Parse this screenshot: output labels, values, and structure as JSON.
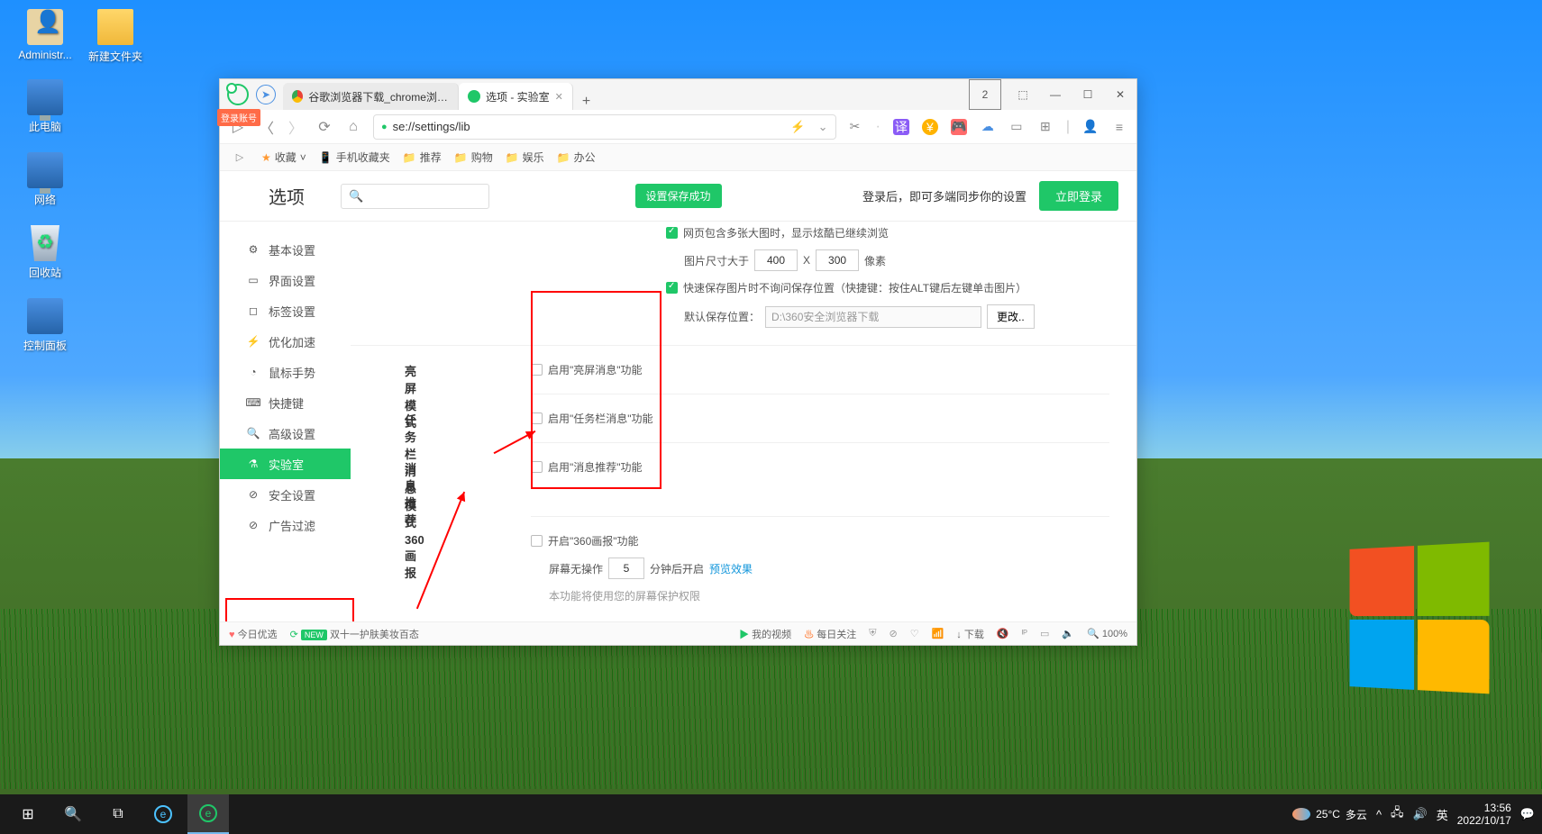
{
  "desktop": {
    "icons1": [
      {
        "label": "Administr...",
        "icon": "user"
      },
      {
        "label": "此电脑",
        "icon": "monitor"
      },
      {
        "label": "网络",
        "icon": "monitor"
      },
      {
        "label": "回收站",
        "icon": "trash"
      },
      {
        "label": "控制面板",
        "icon": "panel"
      }
    ],
    "icons2": [
      {
        "label": "新建文件夹",
        "icon": "folder"
      }
    ]
  },
  "browser": {
    "login_badge": "登录账号",
    "tabs": [
      {
        "label": "谷歌浏览器下载_chrome浏览器官",
        "active": false
      },
      {
        "label": "选项 - 实验室",
        "active": true
      }
    ],
    "tab_count": "2",
    "url": "se://settings/lib",
    "bookmarks": {
      "favorites": "收藏",
      "mobile": "手机收藏夹",
      "items": [
        "推荐",
        "购物",
        "娱乐",
        "办公"
      ]
    },
    "options": {
      "title": "选项",
      "save_notice": "设置保存成功",
      "login_tip": "登录后，即可多端同步你的设置",
      "login_btn": "立即登录"
    },
    "sidebar": [
      {
        "label": "基本设置",
        "icon": "⚙"
      },
      {
        "label": "界面设置",
        "icon": "▭"
      },
      {
        "label": "标签设置",
        "icon": "◻"
      },
      {
        "label": "优化加速",
        "icon": "⚡"
      },
      {
        "label": "鼠标手势",
        "icon": "◔"
      },
      {
        "label": "快捷键",
        "icon": "⌨"
      },
      {
        "label": "高级设置",
        "icon": "🔍"
      },
      {
        "label": "实验室",
        "icon": "⚗",
        "active": true
      },
      {
        "label": "安全设置",
        "icon": "⊘"
      },
      {
        "label": "广告过滤",
        "icon": "⊘"
      }
    ],
    "settings": {
      "top_checkbox": "网页包含多张大图时，显示炫酷已继续浏览",
      "image_size_label": "图片尺寸大于",
      "image_w": "400",
      "image_x": "X",
      "image_h": "300",
      "image_unit": "像素",
      "quick_save": "快速保存图片时不询问保存位置（快捷键：按住ALT键后左键单击图片）",
      "default_save_label": "默认保存位置：",
      "default_save_path": "D:\\360安全浏览器下载",
      "change_btn": "更改..",
      "bright_title": "亮屏模式",
      "bright_opt": "启用\"亮屏消息\"功能",
      "taskbar_title": "任务栏消息模式",
      "taskbar_opt": "启用\"任务栏消息\"功能",
      "push_title": "消息推荐",
      "push_opt": "启用\"消息推荐\"功能",
      "pictorial_title": "360画报",
      "pictorial_opt": "开启\"360画报\"功能",
      "screen_idle_label": "屏幕无操作",
      "screen_idle_val": "5",
      "screen_idle_after": "分钟后开启",
      "preview_link": "预览效果",
      "pictorial_note": "本功能将使用您的屏幕保护权限"
    },
    "statusbar": {
      "today": "今日优选",
      "promo": "双十一护肤美妆百态",
      "video": "我的视频",
      "daily": "每日关注",
      "download": "下载",
      "zoom": "100%"
    }
  },
  "taskbar": {
    "weather_temp": "25°C",
    "weather_desc": "多云",
    "ime": "英",
    "time": "13:56",
    "date": "2022/10/17"
  }
}
